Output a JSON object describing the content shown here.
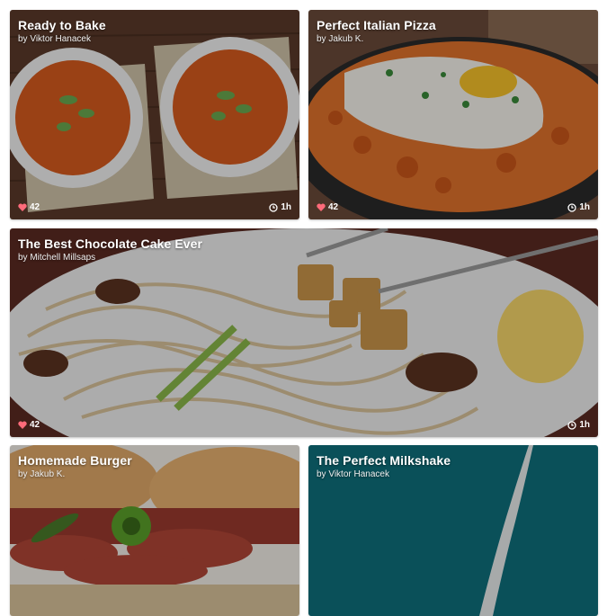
{
  "cards": [
    {
      "title": "Ready to Bake",
      "author": "by Viktor Hanacek",
      "likes": "42",
      "time": "1h"
    },
    {
      "title": "Perfect Italian Pizza",
      "author": "by Jakub K.",
      "likes": "42",
      "time": "1h"
    },
    {
      "title": "The Best Chocolate Cake Ever",
      "author": "by Mitchell Millsaps",
      "likes": "42",
      "time": "1h"
    },
    {
      "title": "Homemade Burger",
      "author": "by Jakub K."
    },
    {
      "title": "The Perfect Milkshake",
      "author": "by Viktor Hanacek"
    }
  ],
  "icons": {
    "like": "heart-icon",
    "time": "clock-icon"
  },
  "colors": {
    "heart": "#ff6b7a",
    "milkshake_bg": "#0e6f7c"
  }
}
